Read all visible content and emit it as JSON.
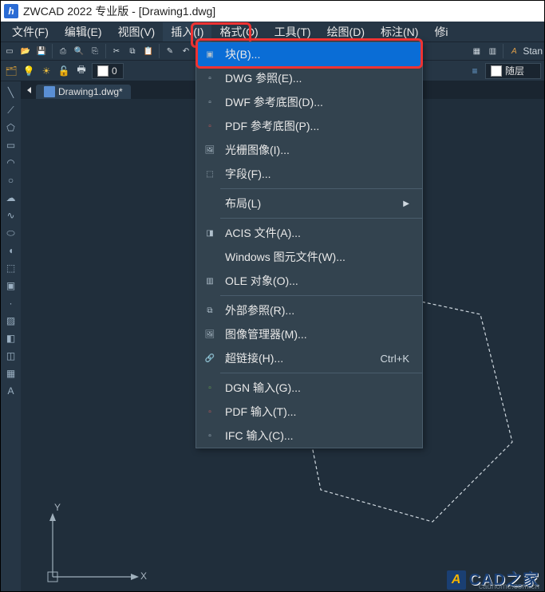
{
  "title": "ZWCAD 2022 专业版 - [Drawing1.dwg]",
  "menubar": {
    "file": "文件(F)",
    "edit": "编辑(E)",
    "view": "视图(V)",
    "insert": "插入(I)",
    "format": "格式(O)",
    "tools": "工具(T)",
    "draw": "绘图(D)",
    "dimension": "标注(N)",
    "modify": "修i"
  },
  "propbar": {
    "layer0": "0",
    "stan": "Stan",
    "bylayer": "随层"
  },
  "tab": {
    "name": "Drawing1.dwg*"
  },
  "menu": {
    "block": "块(B)...",
    "dwgref": "DWG 参照(E)...",
    "dwfref": "DWF 参考底图(D)...",
    "pdfref": "PDF 参考底图(P)...",
    "raster": "光栅图像(I)...",
    "field": "字段(F)...",
    "layout": "布局(L)",
    "acis": "ACIS 文件(A)...",
    "wmf": "Windows 图元文件(W)...",
    "ole": "OLE 对象(O)...",
    "xref": "外部参照(R)...",
    "imgmgr": "图像管理器(M)...",
    "hyper": "超链接(H)...",
    "hyper_short": "Ctrl+K",
    "dgn": "DGN 输入(G)...",
    "pdfin": "PDF 输入(T)...",
    "ifc": "IFC 输入(C)..."
  },
  "axis": {
    "x": "X",
    "y": "Y"
  },
  "watermark": {
    "text": "CAD之家",
    "sub": "cadhome.com.cn",
    "logo": "A"
  }
}
